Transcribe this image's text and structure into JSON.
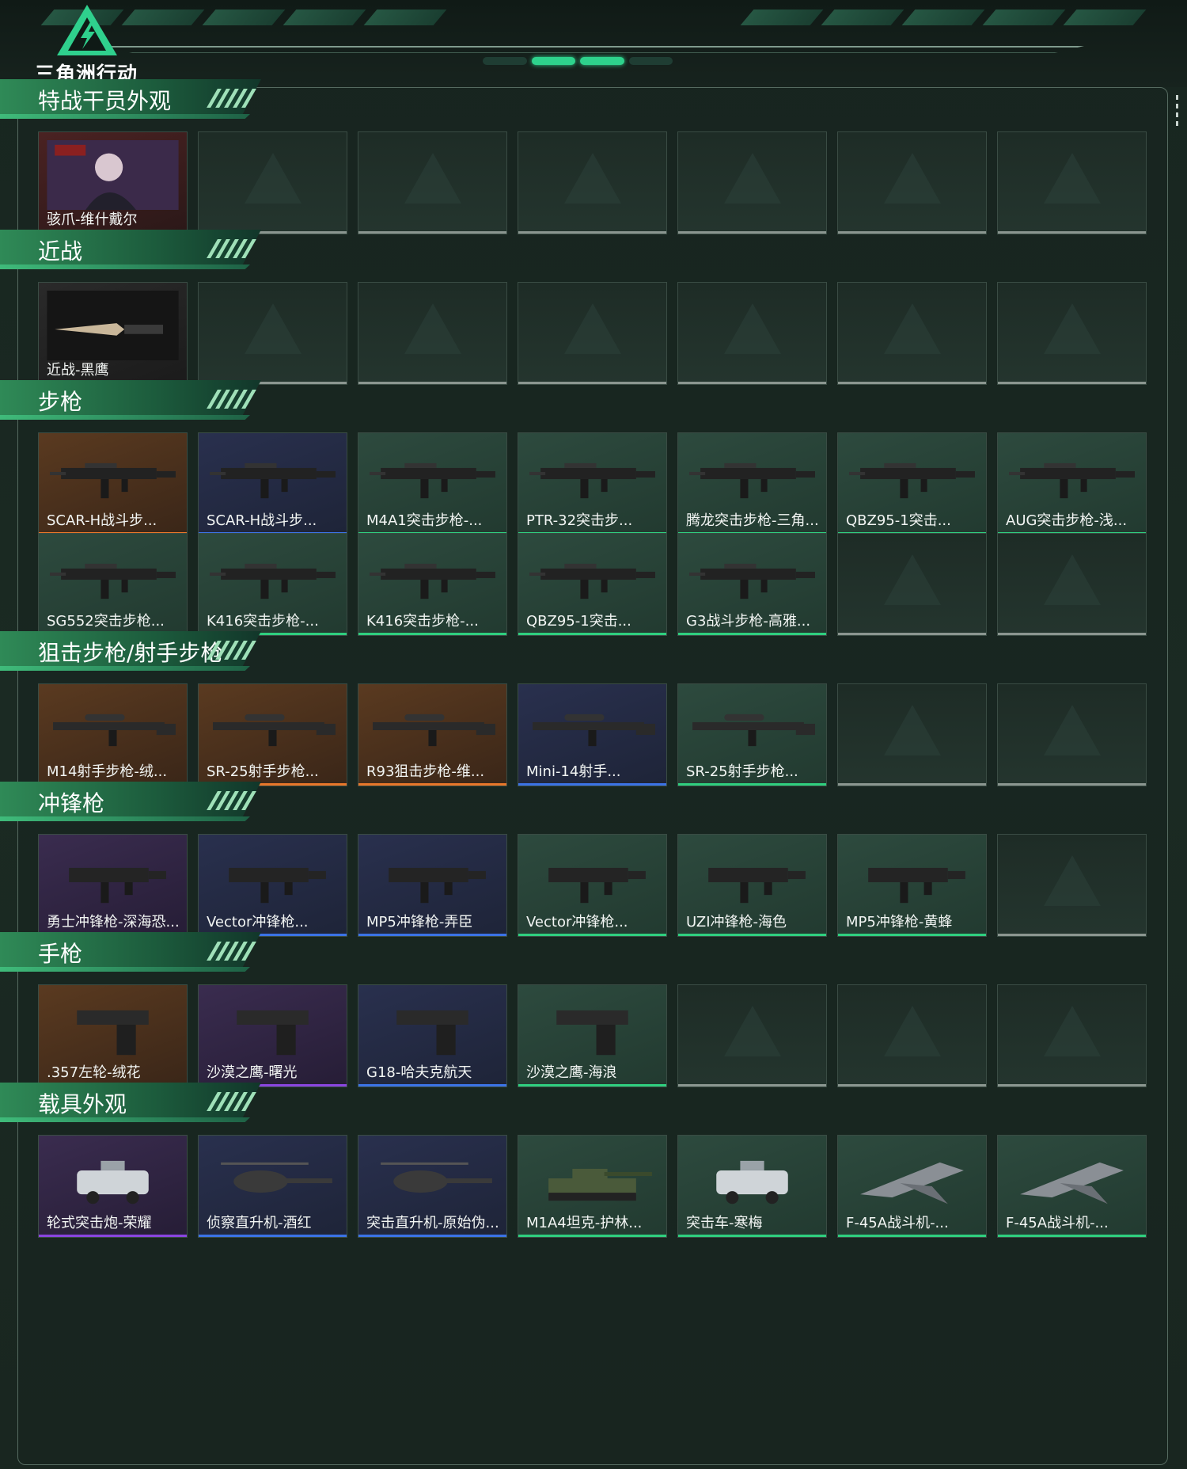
{
  "logo": {
    "text": "三角洲行动"
  },
  "colors": {
    "red": "#d53a3a",
    "gold": "#e9772a",
    "blue": "#3b73e6",
    "green": "#2fcf7f",
    "purple": "#8a45e0",
    "gray": "#8b9690"
  },
  "sections": [
    {
      "title": "特战干员外观",
      "rows": [
        [
          {
            "name": "骇爪-维什戴尔",
            "rarity": "red",
            "icon": "operator-portrait"
          },
          null,
          null,
          null,
          null,
          null,
          null
        ]
      ]
    },
    {
      "title": "近战",
      "rows": [
        [
          {
            "name": "近战-黑鹰",
            "rarity": "gray",
            "icon": "knife"
          },
          null,
          null,
          null,
          null,
          null,
          null
        ]
      ]
    },
    {
      "title": "步枪",
      "rows": [
        [
          {
            "name": "SCAR-H战斗步...",
            "rarity": "gold",
            "icon": "rifle"
          },
          {
            "name": "SCAR-H战斗步...",
            "rarity": "blue",
            "icon": "rifle"
          },
          {
            "name": "M4A1突击步枪-...",
            "rarity": "green",
            "icon": "rifle"
          },
          {
            "name": "PTR-32突击步...",
            "rarity": "green",
            "icon": "rifle"
          },
          {
            "name": "腾龙突击步枪-三角...",
            "rarity": "green",
            "icon": "rifle"
          },
          {
            "name": "QBZ95-1突击...",
            "rarity": "green",
            "icon": "rifle"
          },
          {
            "name": "AUG突击步枪-浅...",
            "rarity": "green",
            "icon": "rifle"
          }
        ],
        [
          {
            "name": "SG552突击步枪...",
            "rarity": "green",
            "icon": "rifle"
          },
          {
            "name": "K416突击步枪-...",
            "rarity": "green",
            "icon": "rifle"
          },
          {
            "name": "K416突击步枪-...",
            "rarity": "green",
            "icon": "rifle"
          },
          {
            "name": "QBZ95-1突击...",
            "rarity": "green",
            "icon": "rifle"
          },
          {
            "name": "G3战斗步枪-高雅...",
            "rarity": "green",
            "icon": "rifle"
          },
          null,
          null
        ]
      ]
    },
    {
      "title": "狙击步枪/射手步枪",
      "rows": [
        [
          {
            "name": "M14射手步枪-绒...",
            "rarity": "gold",
            "icon": "sniper"
          },
          {
            "name": "SR-25射手步枪...",
            "rarity": "gold",
            "icon": "sniper"
          },
          {
            "name": "R93狙击步枪-维...",
            "rarity": "gold",
            "icon": "sniper"
          },
          {
            "name": "Mini-14射手...",
            "rarity": "blue",
            "icon": "sniper"
          },
          {
            "name": "SR-25射手步枪...",
            "rarity": "green",
            "icon": "sniper"
          },
          null,
          null
        ]
      ]
    },
    {
      "title": "冲锋枪",
      "rows": [
        [
          {
            "name": "勇士冲锋枪-深海恐...",
            "rarity": "purple",
            "icon": "smg"
          },
          {
            "name": "Vector冲锋枪...",
            "rarity": "blue",
            "icon": "smg"
          },
          {
            "name": "MP5冲锋枪-弄臣",
            "rarity": "blue",
            "icon": "smg"
          },
          {
            "name": "Vector冲锋枪...",
            "rarity": "green",
            "icon": "smg"
          },
          {
            "name": "UZI冲锋枪-海色",
            "rarity": "green",
            "icon": "smg"
          },
          {
            "name": "MP5冲锋枪-黄蜂",
            "rarity": "green",
            "icon": "smg"
          },
          null
        ]
      ]
    },
    {
      "title": "手枪",
      "rows": [
        [
          {
            "name": ".357左轮-绒花",
            "rarity": "gold",
            "icon": "pistol"
          },
          {
            "name": "沙漠之鹰-曙光",
            "rarity": "purple",
            "icon": "pistol"
          },
          {
            "name": "G18-哈夫克航天",
            "rarity": "blue",
            "icon": "pistol"
          },
          {
            "name": "沙漠之鹰-海浪",
            "rarity": "green",
            "icon": "pistol"
          },
          null,
          null,
          null
        ]
      ]
    },
    {
      "title": "载具外观",
      "rows": [
        [
          {
            "name": "轮式突击炮-荣耀",
            "rarity": "purple",
            "icon": "vehicle"
          },
          {
            "name": "侦察直升机-酒红",
            "rarity": "blue",
            "icon": "helicopter"
          },
          {
            "name": "突击直升机-原始伪...",
            "rarity": "blue",
            "icon": "helicopter"
          },
          {
            "name": "M1A4坦克-护林...",
            "rarity": "green",
            "icon": "tank"
          },
          {
            "name": "突击车-寒梅",
            "rarity": "green",
            "icon": "vehicle"
          },
          {
            "name": "F-45A战斗机-...",
            "rarity": "green",
            "icon": "jet"
          },
          {
            "name": "F-45A战斗机-...",
            "rarity": "green",
            "icon": "jet"
          }
        ]
      ]
    }
  ]
}
